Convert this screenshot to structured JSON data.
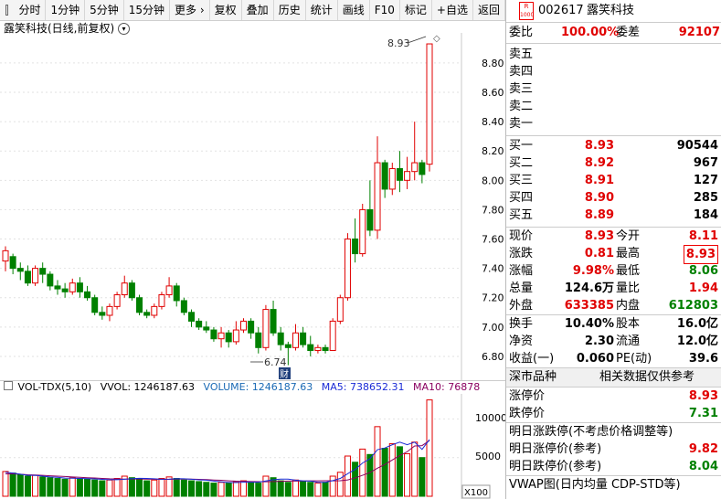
{
  "toolbar": {
    "items": [
      "分时",
      "1分钟",
      "5分钟",
      "15分钟",
      "更多 ›",
      "复权",
      "叠加",
      "历史",
      "统计",
      "画线",
      "F10",
      "标记",
      "+自选",
      "返回"
    ]
  },
  "chart": {
    "title": "露笑科技(日线,前复权)",
    "high_label": "8.93",
    "low_label": "6.74",
    "marker_label": "财",
    "price_ticks": [
      "8.80",
      "8.60",
      "8.40",
      "8.20",
      "8.00",
      "7.80",
      "7.60",
      "7.40",
      "7.20",
      "7.00",
      "6.80"
    ],
    "vol_ticks": [
      "10000",
      "5000"
    ],
    "vol_unit": "X100"
  },
  "volume": {
    "name": "VOL-TDX(5,10)",
    "vvol": "VVOL: 1246187.63",
    "volume": "VOLUME: 1246187.63",
    "ma5": "MA5: 738652.31",
    "ma10": "MA10: 76878"
  },
  "quote": {
    "badge": "R",
    "badge_num": "1000",
    "code": "002617",
    "name": "露笑科技",
    "weibi_label": "委比",
    "weibi": "100.00%",
    "weicha_label": "委差",
    "weicha": "92107",
    "sells": [
      {
        "label": "卖五",
        "price": "",
        "vol": ""
      },
      {
        "label": "卖四",
        "price": "",
        "vol": ""
      },
      {
        "label": "卖三",
        "price": "",
        "vol": ""
      },
      {
        "label": "卖二",
        "price": "",
        "vol": ""
      },
      {
        "label": "卖一",
        "price": "",
        "vol": ""
      }
    ],
    "buys": [
      {
        "label": "买一",
        "price": "8.93",
        "vol": "90544"
      },
      {
        "label": "买二",
        "price": "8.92",
        "vol": "967"
      },
      {
        "label": "买三",
        "price": "8.91",
        "vol": "127"
      },
      {
        "label": "买四",
        "price": "8.90",
        "vol": "285"
      },
      {
        "label": "买五",
        "price": "8.89",
        "vol": "184"
      }
    ],
    "stats": [
      {
        "l1": "现价",
        "v1": "8.93",
        "l2": "今开",
        "v2": "8.11"
      },
      {
        "l1": "涨跌",
        "v1": "0.81",
        "l2": "最高",
        "v2": "8.93"
      },
      {
        "l1": "涨幅",
        "v1": "9.98%",
        "l2": "最低",
        "v2": "8.06"
      },
      {
        "l1": "总量",
        "v1": "124.6万",
        "l2": "量比",
        "v2": "1.94"
      },
      {
        "l1": "外盘",
        "v1": "633385",
        "l2": "内盘",
        "v2": "612803"
      }
    ],
    "stats2": [
      {
        "l1": "换手",
        "v1": "10.40%",
        "l2": "股本",
        "v2": "16.0亿"
      },
      {
        "l1": "净资",
        "v1": "2.30",
        "l2": "流通",
        "v2": "12.0亿"
      },
      {
        "l1": "收益(一)",
        "v1": "0.060",
        "l2": "PE(动)",
        "v2": "39.6"
      }
    ],
    "section_left": "深市品种",
    "section_right": "相关数据仅供参考",
    "limit_up_label": "涨停价",
    "limit_up": "8.93",
    "limit_down_label": "跌停价",
    "limit_down": "7.31",
    "tomorrow_title": "明日涨跌停(不考虑价格调整等)",
    "tomorrow_up_label": "明日涨停价(参考)",
    "tomorrow_up": "9.82",
    "tomorrow_down_label": "明日跌停价(参考)",
    "tomorrow_down": "8.04",
    "vwap": "VWAP图(日内均量 CDP-STD等)"
  },
  "colors": {
    "up": "#e00000",
    "down": "#008000",
    "ma5": "#1b2bd6",
    "ma10": "#8a0060"
  },
  "chart_data": {
    "type": "candlestick",
    "ylim": [
      6.7,
      8.98
    ],
    "vol_ylim": [
      0,
      13000
    ],
    "candles": [
      [
        7.45,
        7.52,
        7.55,
        7.38
      ],
      [
        7.48,
        7.4,
        7.5,
        7.36
      ],
      [
        7.4,
        7.38,
        7.44,
        7.32
      ],
      [
        7.38,
        7.3,
        7.42,
        7.28
      ],
      [
        7.3,
        7.4,
        7.42,
        7.28
      ],
      [
        7.4,
        7.36,
        7.44,
        7.3
      ],
      [
        7.36,
        7.28,
        7.38,
        7.25
      ],
      [
        7.28,
        7.26,
        7.32,
        7.22
      ],
      [
        7.26,
        7.24,
        7.3,
        7.2
      ],
      [
        7.24,
        7.3,
        7.33,
        7.22
      ],
      [
        7.3,
        7.24,
        7.34,
        7.2
      ],
      [
        7.24,
        7.2,
        7.28,
        7.18
      ],
      [
        7.2,
        7.1,
        7.22,
        7.08
      ],
      [
        7.1,
        7.08,
        7.14,
        7.05
      ],
      [
        7.08,
        7.14,
        7.16,
        7.04
      ],
      [
        7.14,
        7.22,
        7.24,
        7.12
      ],
      [
        7.22,
        7.3,
        7.35,
        7.2
      ],
      [
        7.3,
        7.2,
        7.32,
        7.18
      ],
      [
        7.2,
        7.1,
        7.22,
        7.08
      ],
      [
        7.1,
        7.08,
        7.12,
        7.06
      ],
      [
        7.08,
        7.14,
        7.16,
        7.06
      ],
      [
        7.14,
        7.22,
        7.24,
        7.12
      ],
      [
        7.22,
        7.28,
        7.34,
        7.2
      ],
      [
        7.28,
        7.18,
        7.3,
        7.14
      ],
      [
        7.18,
        7.1,
        7.2,
        7.08
      ],
      [
        7.1,
        7.04,
        7.12,
        7.0
      ],
      [
        7.04,
        7.0,
        7.06,
        6.98
      ],
      [
        7.0,
        6.98,
        7.04,
        6.96
      ],
      [
        6.98,
        6.92,
        7.0,
        6.9
      ],
      [
        6.92,
        6.96,
        7.0,
        6.86
      ],
      [
        6.96,
        6.9,
        6.98,
        6.86
      ],
      [
        6.9,
        6.98,
        7.04,
        6.88
      ],
      [
        6.98,
        7.04,
        7.06,
        6.96
      ],
      [
        7.04,
        6.96,
        7.06,
        6.92
      ],
      [
        6.96,
        6.86,
        7.0,
        6.82
      ],
      [
        6.86,
        7.12,
        7.15,
        6.84
      ],
      [
        7.12,
        6.96,
        7.18,
        6.94
      ],
      [
        6.96,
        6.88,
        7.0,
        6.84
      ],
      [
        6.88,
        6.86,
        6.9,
        6.74
      ],
      [
        6.86,
        6.96,
        7.02,
        6.84
      ],
      [
        6.96,
        6.88,
        7.0,
        6.86
      ],
      [
        6.88,
        6.84,
        6.94,
        6.8
      ],
      [
        6.84,
        6.86,
        6.88,
        6.82
      ],
      [
        6.86,
        6.84,
        6.88,
        6.82
      ],
      [
        6.84,
        7.04,
        7.06,
        6.84
      ],
      [
        7.04,
        7.2,
        7.22,
        7.02
      ],
      [
        7.2,
        7.6,
        7.64,
        7.18
      ],
      [
        7.6,
        7.5,
        7.74,
        7.44
      ],
      [
        7.5,
        7.8,
        7.84,
        7.48
      ],
      [
        7.8,
        7.66,
        8.0,
        7.62
      ],
      [
        7.66,
        8.12,
        8.3,
        7.6
      ],
      [
        8.12,
        7.94,
        8.14,
        7.88
      ],
      [
        7.94,
        8.08,
        8.12,
        7.9
      ],
      [
        8.08,
        8.0,
        8.2,
        7.92
      ],
      [
        8.0,
        8.06,
        8.16,
        7.94
      ],
      [
        8.06,
        8.12,
        8.4,
        8.0
      ],
      [
        8.12,
        8.04,
        8.14,
        7.98
      ],
      [
        8.11,
        8.93,
        8.93,
        8.06
      ]
    ],
    "volumes": [
      3200,
      3000,
      2800,
      2600,
      2700,
      2500,
      2400,
      2300,
      2200,
      2400,
      2300,
      2200,
      2100,
      2000,
      2100,
      2300,
      2600,
      2400,
      2200,
      2000,
      2100,
      2300,
      2500,
      2300,
      2100,
      2000,
      1900,
      1800,
      1700,
      1800,
      1700,
      1900,
      2000,
      1800,
      1700,
      2600,
      2400,
      2000,
      1800,
      2100,
      1900,
      1800,
      1700,
      1800,
      2600,
      3100,
      5200,
      4400,
      6100,
      5400,
      9000,
      6200,
      6800,
      6400,
      5500,
      7000,
      5000,
      12460
    ],
    "ma5": [
      3100,
      3000,
      2850,
      2700,
      2700,
      2600,
      2500,
      2450,
      2350,
      2330,
      2300,
      2280,
      2240,
      2180,
      2140,
      2140,
      2200,
      2280,
      2320,
      2300,
      2260,
      2200,
      2220,
      2280,
      2260,
      2200,
      2120,
      2080,
      1960,
      1860,
      1780,
      1780,
      1820,
      1820,
      1820,
      1980,
      2140,
      2220,
      2220,
      2080,
      2000,
      1960,
      1800,
      1800,
      2020,
      2300,
      2920,
      3460,
      4300,
      4850,
      6020,
      6240,
      6660,
      7000,
      6660,
      7000,
      6060,
      7330
    ],
    "ma10": [
      2900,
      2900,
      2850,
      2780,
      2750,
      2700,
      2650,
      2600,
      2560,
      2500,
      2450,
      2400,
      2360,
      2310,
      2260,
      2240,
      2220,
      2230,
      2230,
      2220,
      2200,
      2180,
      2190,
      2210,
      2230,
      2220,
      2180,
      2150,
      2100,
      2070,
      2000,
      1950,
      1930,
      1910,
      1890,
      1880,
      1900,
      1930,
      1960,
      1960,
      1980,
      1990,
      2000,
      2010,
      2000,
      2010,
      2110,
      2370,
      2710,
      3070,
      3630,
      4120,
      4690,
      5260,
      5760,
      6500,
      6550,
      7200
    ]
  }
}
